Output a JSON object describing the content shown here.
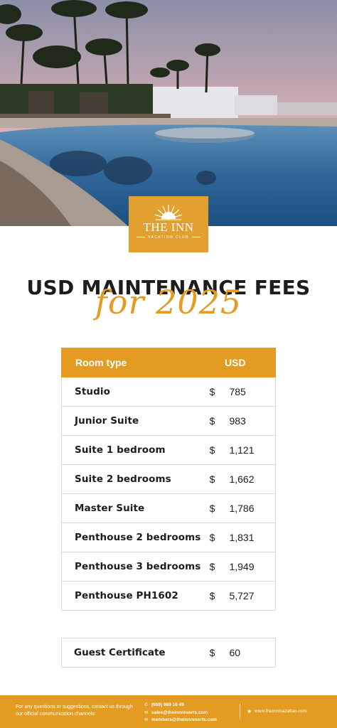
{
  "brand": {
    "name": "THE INN",
    "tagline": "VACATION CLUB"
  },
  "heading": {
    "title": "USD MAINTENANCE FEES",
    "subtitle": "for 2025"
  },
  "table": {
    "col_room_type": "Room type",
    "col_usd": "USD",
    "currency_symbol": "$",
    "rows": [
      {
        "name": "Studio",
        "value": "785"
      },
      {
        "name": "Junior Suite",
        "value": "983"
      },
      {
        "name": "Suite 1 bedroom",
        "value": "1,121"
      },
      {
        "name": "Suite 2 bedrooms",
        "value": "1,662"
      },
      {
        "name": "Master Suite",
        "value": "1,786"
      },
      {
        "name": "Penthouse 2 bedrooms",
        "value": "1,831"
      },
      {
        "name": "Penthouse 3 bedrooms",
        "value": "1,949"
      },
      {
        "name": "Penthouse PH1602",
        "value": "5,727"
      }
    ]
  },
  "guest": {
    "name": "Guest Certificate",
    "currency_symbol": "$",
    "value": "60"
  },
  "footer": {
    "note": "For any questions or suggestions, contact us through our official communication channels:",
    "phone": "(669) 989 16 49",
    "email_sales": "sales@theinnresorts.com",
    "email_members": "members@theinnresorts.com",
    "website": "www.theinnmazatlan.com"
  },
  "colors": {
    "accent": "#e39b22",
    "text": "#1d1d1b"
  },
  "icons": [
    "sun-logo-icon",
    "phone-icon",
    "mail-icon",
    "globe-icon"
  ]
}
